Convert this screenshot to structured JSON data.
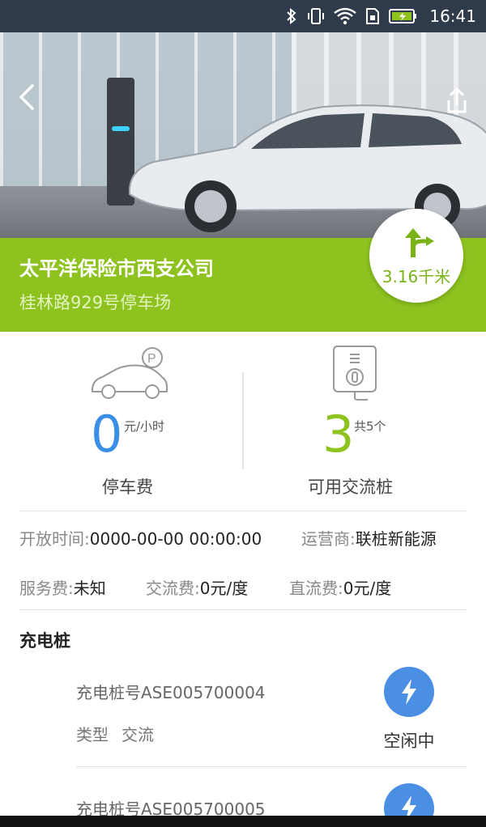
{
  "status_bar": {
    "time": "16:41",
    "icons": [
      "bluetooth-icon",
      "vibrate-icon",
      "wifi-icon",
      "sim-icon",
      "battery-charging-icon"
    ]
  },
  "header": {
    "back_icon": "chevron-left-icon",
    "share_icon": "share-icon"
  },
  "station": {
    "name": "太平洋保险市西支公司",
    "address": "桂林路929号停车场",
    "distance": "3.16千米",
    "banner_color": "#8dc21f"
  },
  "stats": {
    "parking": {
      "value": "0",
      "unit": "元/小时",
      "label": "停车费",
      "color": "#3b8ee6"
    },
    "ac_piles": {
      "value": "3",
      "unit": "共5个",
      "label": "可用交流桩",
      "color": "#8dc21f"
    }
  },
  "info": {
    "open_time_label": "开放时间:",
    "open_time_value": "0000-00-00 00:00:00",
    "operator_label": "运营商:",
    "operator_value": "联桩新能源",
    "service_fee_label": "服务费:",
    "service_fee_value": "未知",
    "ac_fee_label": "交流费:",
    "ac_fee_value": "0元/度",
    "dc_fee_label": "直流费:",
    "dc_fee_value": "0元/度"
  },
  "piles_section": {
    "title": "充电桩",
    "items": [
      {
        "title": "充电桩号ASE005700004",
        "type_label": "类型",
        "type_value": "交流",
        "status": "空闲中",
        "icon": "lightning-bolt-icon"
      },
      {
        "title": "充电桩号ASE005700005",
        "icon": "lightning-bolt-icon"
      }
    ]
  }
}
